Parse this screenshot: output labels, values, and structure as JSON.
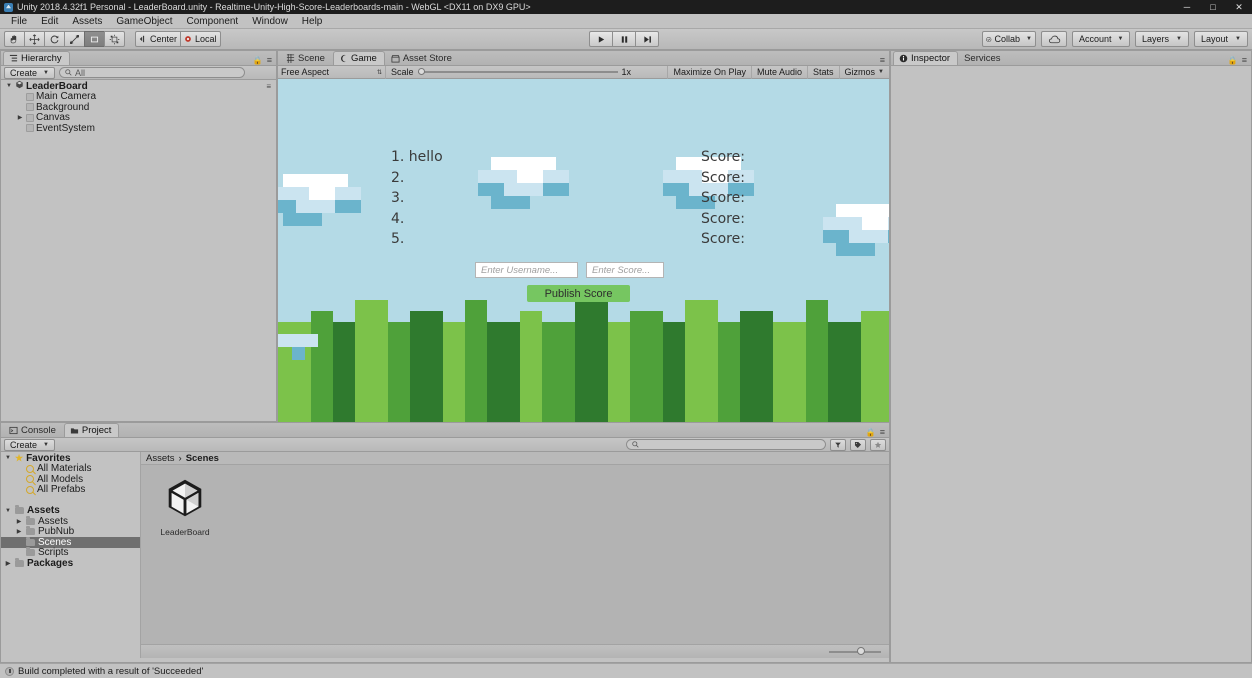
{
  "window": {
    "title": "Unity 2018.4.32f1 Personal - LeaderBoard.unity - Realtime-Unity-High-Score-Leaderboards-main - WebGL <DX11 on DX9 GPU>",
    "minimize": "─",
    "maximize": "□",
    "close": "✕"
  },
  "menu": [
    "File",
    "Edit",
    "Assets",
    "GameObject",
    "Component",
    "Window",
    "Help"
  ],
  "toolbar": {
    "tools": [
      {
        "name": "hand-tool",
        "active": false
      },
      {
        "name": "move-tool",
        "active": false
      },
      {
        "name": "rotate-tool",
        "active": false
      },
      {
        "name": "scale-tool",
        "active": false
      },
      {
        "name": "rect-tool",
        "active": true
      },
      {
        "name": "transform-tool",
        "active": false
      }
    ],
    "pivot_label": "Center",
    "space_label": "Local",
    "play_label": "play-button",
    "pause_label": "pause-button",
    "step_label": "step-button",
    "collab_label": "Collab",
    "cloud_label": "cloud-button",
    "account_label": "Account",
    "layers_label": "Layers",
    "layout_label": "Layout"
  },
  "hierarchy": {
    "tab": "Hierarchy",
    "create_label": "Create",
    "search_placeholder": "All",
    "items": [
      {
        "label": "LeaderBoard",
        "depth": 0,
        "twist": "▼",
        "type": "scene"
      },
      {
        "label": "Main Camera",
        "depth": 1,
        "twist": "",
        "type": "gameobject"
      },
      {
        "label": "Background",
        "depth": 1,
        "twist": "",
        "type": "gameobject"
      },
      {
        "label": "Canvas",
        "depth": 1,
        "twist": "▶",
        "type": "gameobject"
      },
      {
        "label": "EventSystem",
        "depth": 1,
        "twist": "",
        "type": "gameobject"
      }
    ]
  },
  "gameview": {
    "tabs": [
      {
        "label": "Scene",
        "active": false
      },
      {
        "label": "Game",
        "active": true
      },
      {
        "label": "Asset Store",
        "active": false
      }
    ],
    "aspect": "Free Aspect",
    "scale_label": "Scale",
    "scale_value": "1x",
    "maximize_on_play": "Maximize On Play",
    "mute_audio": "Mute Audio",
    "stats": "Stats",
    "gizmos": "Gizmos",
    "leaderboard": [
      {
        "rank": "1. hello",
        "score": "Score:"
      },
      {
        "rank": "2.",
        "score": "Score:"
      },
      {
        "rank": "3.",
        "score": "Score:"
      },
      {
        "rank": "4.",
        "score": "Score:"
      },
      {
        "rank": "5.",
        "score": "Score:"
      }
    ],
    "username_placeholder": "Enter Username...",
    "username_value": "",
    "score_placeholder": "Enter Score...",
    "score_value": "",
    "publish_label": "Publish Score",
    "colors": {
      "sky": "#b4dae6",
      "cloud_white": "#ffffff",
      "cloud_light": "#cbe4f0",
      "cloud_mid": "#6bb4cc",
      "grass_light": "#7cc24a",
      "grass_mid": "#4fa13a",
      "grass_dark": "#2f7a2e",
      "mushroom_cap": "#d6202a",
      "mushroom_stem": "#f0dfb0",
      "dirt": "#4a2a16",
      "button_green": "#76c661"
    }
  },
  "inspector": {
    "tabs": [
      {
        "label": "Inspector",
        "active": true
      },
      {
        "label": "Services",
        "active": false
      }
    ]
  },
  "project": {
    "tabs": [
      {
        "label": "Console",
        "active": false
      },
      {
        "label": "Project",
        "active": true
      }
    ],
    "create_label": "Create",
    "search_placeholder": "",
    "tree": [
      {
        "label": "Favorites",
        "depth": 0,
        "twist": "▼",
        "icon": "star",
        "bold": true,
        "selected": false
      },
      {
        "label": "All Materials",
        "depth": 1,
        "twist": "",
        "icon": "search",
        "bold": false,
        "selected": false
      },
      {
        "label": "All Models",
        "depth": 1,
        "twist": "",
        "icon": "search",
        "bold": false,
        "selected": false
      },
      {
        "label": "All Prefabs",
        "depth": 1,
        "twist": "",
        "icon": "search",
        "bold": false,
        "selected": false
      },
      {
        "label": "",
        "depth": 0,
        "twist": "",
        "icon": "none",
        "bold": false,
        "selected": false
      },
      {
        "label": "Assets",
        "depth": 0,
        "twist": "▼",
        "icon": "folder",
        "bold": true,
        "selected": false
      },
      {
        "label": "Assets",
        "depth": 1,
        "twist": "▶",
        "icon": "folder",
        "bold": false,
        "selected": false
      },
      {
        "label": "PubNub",
        "depth": 1,
        "twist": "▶",
        "icon": "folder",
        "bold": false,
        "selected": false
      },
      {
        "label": "Scenes",
        "depth": 1,
        "twist": "",
        "icon": "folder",
        "bold": false,
        "selected": true
      },
      {
        "label": "Scripts",
        "depth": 1,
        "twist": "",
        "icon": "folder",
        "bold": false,
        "selected": false
      },
      {
        "label": "Packages",
        "depth": 0,
        "twist": "▶",
        "icon": "folder",
        "bold": true,
        "selected": false
      }
    ],
    "breadcrumb": [
      "Assets",
      "Scenes"
    ],
    "assets": [
      {
        "label": "LeaderBoard",
        "icon": "unity-scene-icon"
      }
    ]
  },
  "status": {
    "message": "Build completed with a result of 'Succeeded'"
  }
}
